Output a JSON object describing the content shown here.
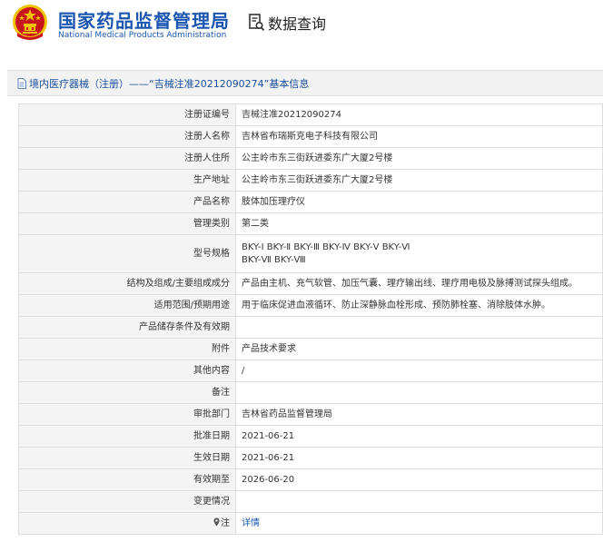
{
  "header": {
    "title_cn": "国家药品监督管理局",
    "title_en": "National Medical Products Administration",
    "query_label": "数据查询",
    "colors": {
      "brand": "#1a56b0",
      "emblem_red": "#c8161d",
      "emblem_gold": "#f2c200"
    }
  },
  "breadcrumb": {
    "text": "境内医疗器械（注册）——“吉械注准20212090274”基本信息",
    "icon": "document-icon"
  },
  "record": {
    "rows": [
      {
        "label": "注册证编号",
        "value": "吉械注准20212090274"
      },
      {
        "label": "注册人名称",
        "value": "吉林省布瑞斯克电子科技有限公司"
      },
      {
        "label": "注册人住所",
        "value": "公主岭市东三街跃进委东广大厦2号楼"
      },
      {
        "label": "生产地址",
        "value": "公主岭市东三街跃进委东广大厦2号楼"
      },
      {
        "label": "产品名称",
        "value": "肢体加压理疗仪"
      },
      {
        "label": "管理类别",
        "value": "第二类"
      },
      {
        "label": "型号规格",
        "value_line1": "BKY-Ⅰ BKY-Ⅱ BKY-Ⅲ BKY-Ⅳ BKY-Ⅴ BKY-Ⅵ",
        "value_line2": "BKY-Ⅶ BKY-Ⅷ"
      },
      {
        "label": "结构及组成/主要组成成分",
        "value": "产品由主机、充气软管、加压气囊、理疗输出线、理疗用电极及脉搏测试探头组成。"
      },
      {
        "label": "适用范围/预期用途",
        "value": "用于临床促进血液循环、防止深静脉血栓形成、预防肺栓塞、消除肢体水肿。"
      },
      {
        "label": "产品储存条件及有效期",
        "value": ""
      },
      {
        "label": "附件",
        "value": "产品技术要求"
      },
      {
        "label": "其他内容",
        "value": "/"
      },
      {
        "label": "备注",
        "value": ""
      },
      {
        "label": "审批部门",
        "value": "吉林省药品监督管理局"
      },
      {
        "label": "批准日期",
        "value": "2021-06-21"
      },
      {
        "label": "生效日期",
        "value": "2021-06-21"
      },
      {
        "label": "有效期至",
        "value": "2026-06-20"
      },
      {
        "label": "变更情况",
        "value": ""
      },
      {
        "label": "注",
        "value": "详情",
        "icon": "location-pin-icon"
      }
    ]
  }
}
